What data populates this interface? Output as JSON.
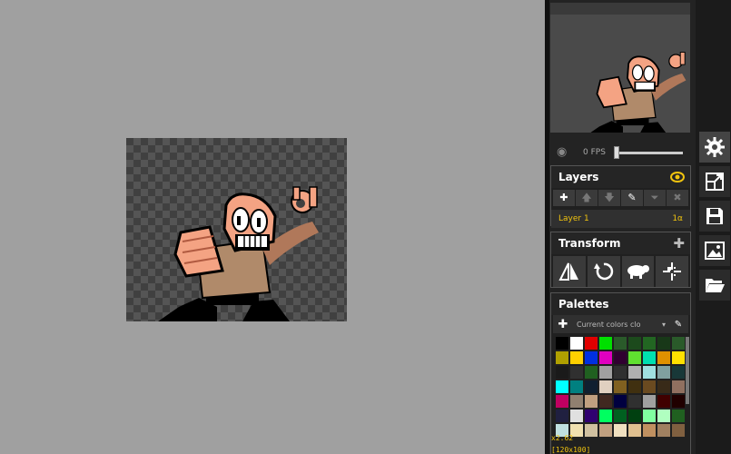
{
  "preview": {
    "fps_label": "0 FPS",
    "fps_value": 0
  },
  "layers": {
    "title": "Layers",
    "items": [
      {
        "name": "Layer 1",
        "opacity": "1α"
      }
    ],
    "tools": [
      "add-layer-icon",
      "move-up-icon",
      "move-down-icon",
      "edit-icon",
      "merge-icon",
      "delete-icon"
    ]
  },
  "transform": {
    "title": "Transform",
    "tools": [
      "flip-icon",
      "rotate-icon",
      "clone-icon",
      "center-icon"
    ]
  },
  "palettes": {
    "title": "Palettes",
    "selected": "Current colors clo",
    "swatches": [
      "#000000",
      "#ffffff",
      "#e00000",
      "#00e000",
      "#2a5a2a",
      "#1c4a1c",
      "#226622",
      "#183818",
      "#2a5a2a",
      "#b0a000",
      "#ffd000",
      "#0030e0",
      "#e000c0",
      "#300030",
      "#60e030",
      "#00e0b0",
      "#e09000",
      "#ffe000",
      "#1a1a1a",
      "#303030",
      "#206020",
      "#a0a0a0",
      "#303030",
      "#b0b0b0",
      "#a0e0e0",
      "#80a0a0",
      "#183838",
      "#00ffff",
      "#008080",
      "#102030",
      "#e0d0c0",
      "#806020",
      "#403010",
      "#6a4a20",
      "#382a18",
      "#907060",
      "#c00060",
      "#908070",
      "#c0a080",
      "#402820",
      "#000040",
      "#303030",
      "#a0a0a0",
      "#400000",
      "#200000",
      "#202040",
      "#e0e0e0",
      "#300070",
      "#00ff60",
      "#006020",
      "#004010",
      "#80ffa0",
      "#b0ffc0",
      "#206020",
      "#c0e0e0",
      "#f0e0b0",
      "#d0c0a0",
      "#c0a080",
      "#f0e0c0",
      "#e0c090",
      "#c09060",
      "#a08060",
      "#806040"
    ]
  },
  "status": {
    "zoom": "x2.62",
    "size": "[120x100]"
  },
  "side_toolbar": [
    "settings-icon",
    "resize-icon",
    "save-icon",
    "image-icon",
    "open-folder-icon"
  ]
}
